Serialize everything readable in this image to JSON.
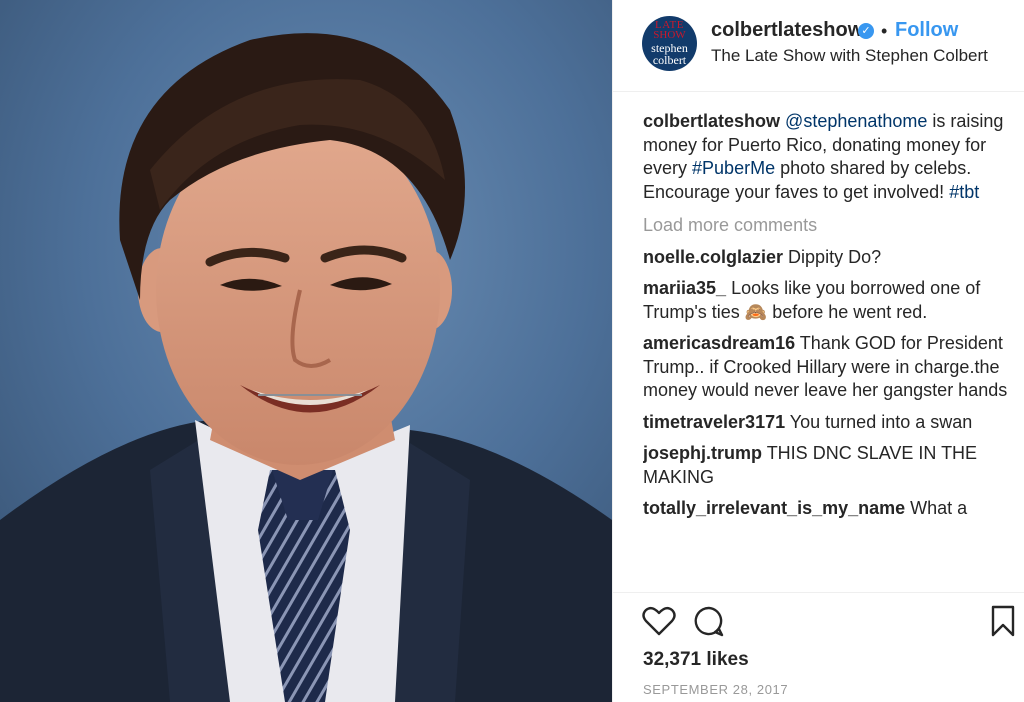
{
  "header": {
    "avatar_lines": [
      "LATE",
      "SHOW",
      "stephen",
      "colbert"
    ],
    "username": "colbertlateshow",
    "verified_icon": "verified-badge-icon",
    "separator": "•",
    "follow_label": "Follow",
    "full_name": "The Late Show with Stephen Colbert"
  },
  "caption": {
    "username": "colbertlateshow",
    "mention": "@stephenathome",
    "text_1": " is raising money for Puerto Rico, donating money for every ",
    "hashtag_1": "#PuberMe",
    "text_2": " photo shared by celebs. Encourage your faves to get involved! ",
    "hashtag_2": "#tbt"
  },
  "load_more": "Load more comments",
  "comments": [
    {
      "username": "noelle.colglazier",
      "text": " Dippity Do?"
    },
    {
      "username": "mariia35_",
      "text": " Looks like you borrowed one of Trump's ties 🙈  before he went red."
    },
    {
      "username": "americasdream16",
      "text": " Thank GOD for President Trump.. if Crooked Hillary were in charge.the money would never leave her gangster hands"
    },
    {
      "username": "timetraveler3171",
      "text": " You turned into a swan"
    },
    {
      "username": "josephj.trump",
      "text": " THIS DNC SLAVE IN THE MAKING"
    },
    {
      "username": "totally_irrelevant_is_my_name",
      "text": " What a"
    }
  ],
  "footer": {
    "icons": [
      "heart-icon",
      "comment-icon",
      "bookmark-icon"
    ],
    "likes": "32,371 likes",
    "date": "SEPTEMBER 28, 2017"
  },
  "colors": {
    "accent": "#3897f0",
    "link": "#003569",
    "muted": "#999999",
    "text": "#262626"
  }
}
